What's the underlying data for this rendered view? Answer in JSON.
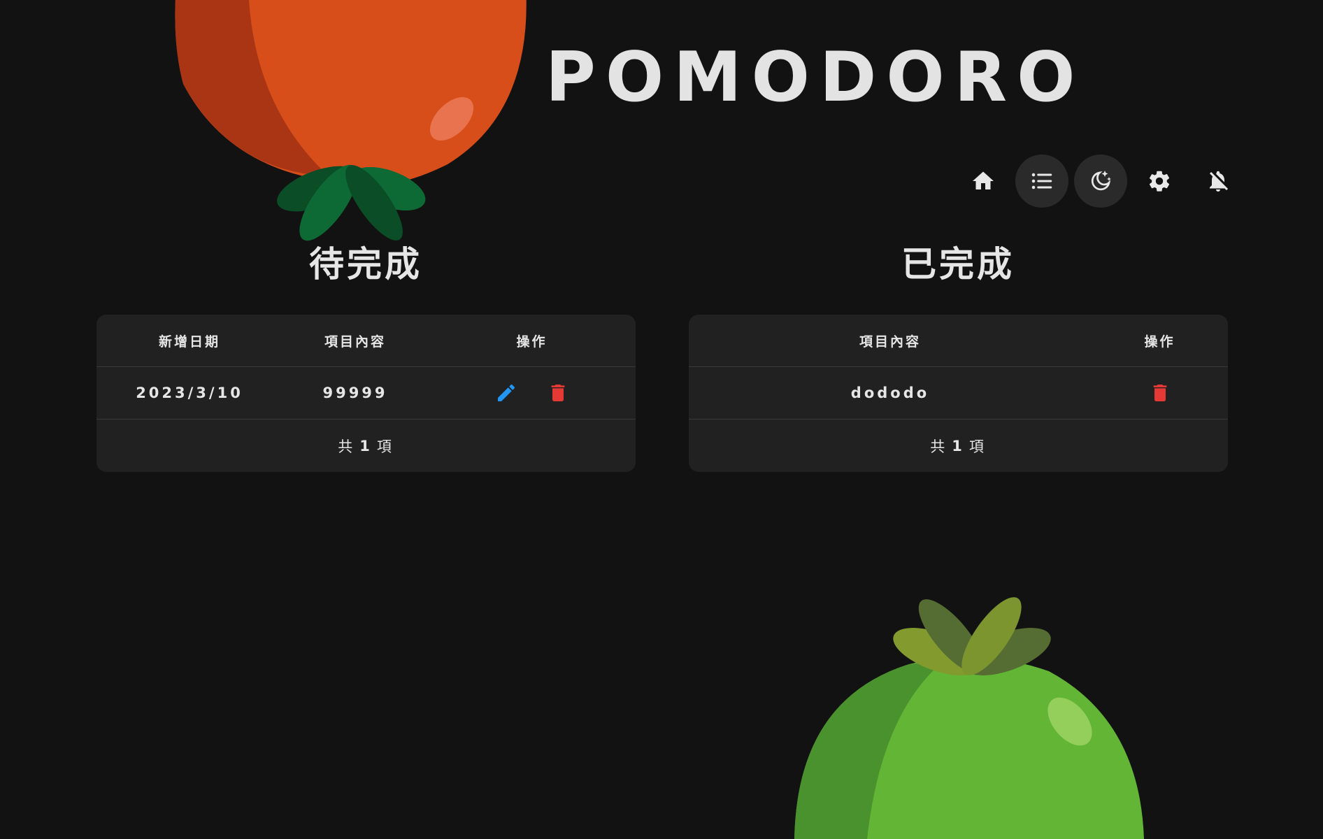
{
  "app": {
    "title": "POMODORO"
  },
  "colors": {
    "background": "#121212",
    "card": "#212121",
    "edit": "#2196f3",
    "delete": "#e53935",
    "tomato_red": "#d84e1a",
    "tomato_green": "#62b535"
  },
  "nav": [
    {
      "name": "home-icon",
      "active": false
    },
    {
      "name": "list-icon",
      "active": true
    },
    {
      "name": "moon-stars-icon",
      "active": true
    },
    {
      "name": "gear-icon",
      "active": false
    },
    {
      "name": "bell-off-icon",
      "active": false
    }
  ],
  "pending": {
    "title": "待完成",
    "headers": [
      "新增日期",
      "項目內容",
      "操作"
    ],
    "rows": [
      {
        "date": "2023/3/10",
        "content": "99999"
      }
    ],
    "footer": {
      "prefix": "共",
      "count": "1",
      "suffix": "項"
    }
  },
  "completed": {
    "title": "已完成",
    "headers": [
      "項目內容",
      "操作"
    ],
    "rows": [
      {
        "content": "dododo"
      }
    ],
    "footer": {
      "prefix": "共",
      "count": "1",
      "suffix": "項"
    }
  }
}
